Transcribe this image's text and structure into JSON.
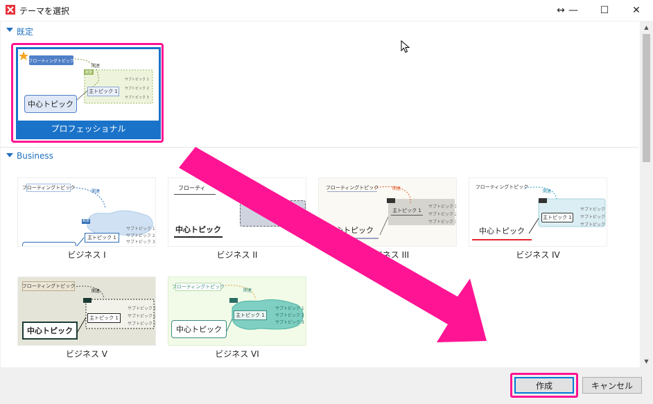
{
  "window": {
    "title": "テーマを選択",
    "move_glyph": "↔",
    "minimize_glyph": "—",
    "maximize_glyph": "☐",
    "close_glyph": "✕"
  },
  "sections": [
    {
      "label": "既定"
    },
    {
      "label": "Business"
    }
  ],
  "themes": {
    "professional": "プロフェッショナル",
    "b1": "ビジネス I",
    "b2": "ビジネス II",
    "b3": "ビジネス III",
    "b4": "ビジネス IV",
    "b5": "ビジネス V",
    "b6": "ビジネス VI"
  },
  "thumbnail_text": {
    "floating": "フローティングトピック",
    "floating_short": "フローティ",
    "central": "中心トピック",
    "main": "主トピック 1",
    "relation": "関連",
    "summary": "概要",
    "sub1": "サブトピック 1",
    "sub2": "サブトピック 2",
    "sub3": "サブトピック 3"
  },
  "buttons": {
    "create": "作成",
    "cancel": "キャンセル"
  },
  "colors": {
    "accent": "#1e6fbf",
    "highlight": "#ff1493",
    "selection": "#1a73c9"
  }
}
